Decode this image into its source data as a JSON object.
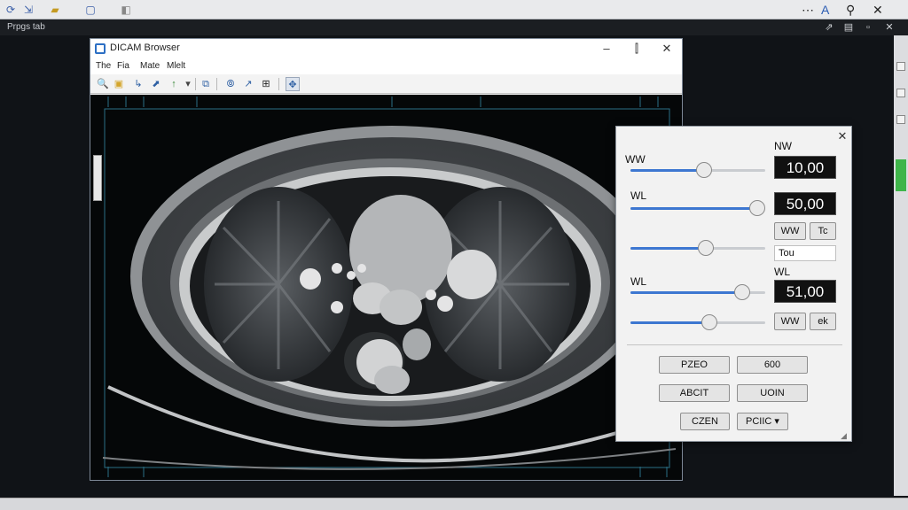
{
  "desktop": {
    "app_name": "Prpgs tab",
    "top_icons": [
      "refresh-icon",
      "export-icon",
      "folder-icon",
      "document-icon",
      "display-icon"
    ],
    "top_right": {
      "dots": "⋯",
      "nav": "A",
      "search": "⚲",
      "close": "✕"
    },
    "sub_icons": [
      "pin-icon",
      "copy-icon",
      "window-icon"
    ]
  },
  "window": {
    "title": "DICAM Browser",
    "controls": {
      "minimize": "–",
      "maximize": "⫿",
      "close": "✕"
    },
    "menu": [
      "The",
      "Fia",
      "Mate",
      "Mlelt"
    ],
    "tools": [
      "🔍",
      "▣",
      "↳",
      "⬈",
      "↑",
      "▾",
      "⧉",
      "⦾",
      "↗",
      "⊞",
      "✥"
    ]
  },
  "panel": {
    "close": "✕",
    "row1": {
      "label": "WW",
      "value": "10,00",
      "value_label": "NW",
      "slider": 0.55
    },
    "row2": {
      "label": "WL",
      "value": "50,00",
      "slider": 1.0
    },
    "row3": {
      "btn1": "WW",
      "btn2": "Tc",
      "field": "Tou",
      "slider": 0.57
    },
    "row4": {
      "label": "WL",
      "value_label": "WL",
      "value": "51,00",
      "slider": 0.87
    },
    "row5": {
      "btn1": "WW",
      "btn2": "ek",
      "slider": 0.6
    },
    "buttons": {
      "b1": "PZEO",
      "b2": "600",
      "b3": "ABCIT",
      "b4": "UOIN",
      "b5": "CZEN",
      "b6": "PCIIC ▾"
    }
  }
}
